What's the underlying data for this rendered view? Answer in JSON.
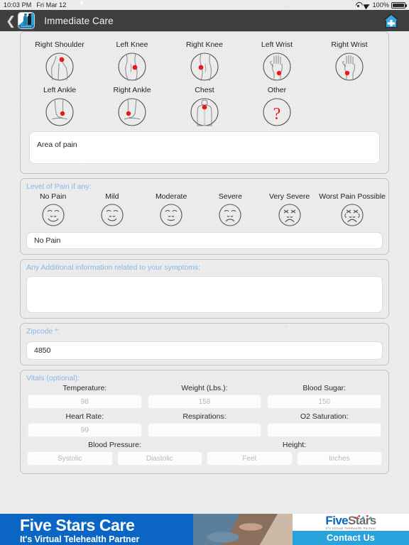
{
  "status_bar": {
    "time": "10:03 PM",
    "date": "Fri Mar 12",
    "battery_text": "100%",
    "wifi_icon": "wifi-icon",
    "location_icon": "location-arrow-icon",
    "battery_icon": "battery-icon"
  },
  "nav": {
    "back_icon": "back-chevron-icon",
    "app_logo_name": "fivestars-logo-icon",
    "app_logo_brand": "FiveStars",
    "title": "Immediate Care",
    "home_icon": "home-plus-icon"
  },
  "body_parts": {
    "rows": [
      [
        {
          "label": "Right Shoulder",
          "icon": "shoulder-icon"
        },
        {
          "label": "Left Knee",
          "icon": "knee-icon"
        },
        {
          "label": "Right Knee",
          "icon": "knee-icon"
        },
        {
          "label": "Left Wrist",
          "icon": "wrist-icon"
        },
        {
          "label": "Right Wrist",
          "icon": "wrist-icon"
        }
      ],
      [
        {
          "label": "Left Ankle",
          "icon": "ankle-icon"
        },
        {
          "label": "Right Ankle",
          "icon": "ankle-icon"
        },
        {
          "label": "Chest",
          "icon": "chest-icon"
        },
        {
          "label": "Other",
          "icon": "question-mark-icon"
        },
        {
          "label": "",
          "icon": ""
        }
      ]
    ],
    "area_of_pain_value": "Area of pain",
    "area_of_pain_placeholder": "Area of pain"
  },
  "pain_level": {
    "label": "Level of Pain if any:",
    "options": [
      {
        "label": "No Pain",
        "face": "face-happy-icon"
      },
      {
        "label": "Mild",
        "face": "face-slight-smile-icon"
      },
      {
        "label": "Moderate",
        "face": "face-neutral-smile-icon"
      },
      {
        "label": "Severe",
        "face": "face-frown-icon"
      },
      {
        "label": "Very Severe",
        "face": "face-distress-icon"
      },
      {
        "label": "Worst Pain Possible",
        "face": "face-crying-icon"
      }
    ],
    "selected_value": "No Pain"
  },
  "symptoms": {
    "label": "Any Additional information related to your symptoms:",
    "value": "",
    "placeholder": ""
  },
  "zipcode": {
    "label": "Zipcode *:",
    "value": "4850",
    "placeholder": ""
  },
  "vitals": {
    "label": "Vitals (optional):",
    "row1": [
      {
        "label": "Temperature:",
        "placeholder": "98",
        "value": ""
      },
      {
        "label": "Weight (Lbs.):",
        "placeholder": "158",
        "value": ""
      },
      {
        "label": "Blood Sugar:",
        "placeholder": "150",
        "value": ""
      }
    ],
    "row2": [
      {
        "label": "Heart Rate:",
        "placeholder": "99",
        "value": ""
      },
      {
        "label": "Respirations:",
        "placeholder": "",
        "value": ""
      },
      {
        "label": "O2 Saturation:",
        "placeholder": "",
        "value": ""
      }
    ],
    "row3_labels": [
      "Blood Pressure:",
      "Height:"
    ],
    "row3": [
      {
        "placeholder": "Systolic",
        "value": ""
      },
      {
        "placeholder": "Diastolic",
        "value": ""
      },
      {
        "placeholder": "Feet",
        "value": ""
      },
      {
        "placeholder": "Inches",
        "value": ""
      }
    ]
  },
  "ad": {
    "title": "Five Stars Care",
    "subtitle": "It's Virtual Telehealth Partner",
    "logo_blue": "Five",
    "logo_gray": "Stars",
    "logo_tagline": "It's Virtual Telehealth Partner",
    "contact_label": "Contact Us"
  },
  "colors": {
    "nav_bar": "#3f3f40",
    "accent_blue": "#86b6e4",
    "brand_blue": "#0a66c2",
    "contact_blue": "#29a3dc",
    "pain_marker_red": "#e8191b",
    "page_bg": "#ededee"
  }
}
